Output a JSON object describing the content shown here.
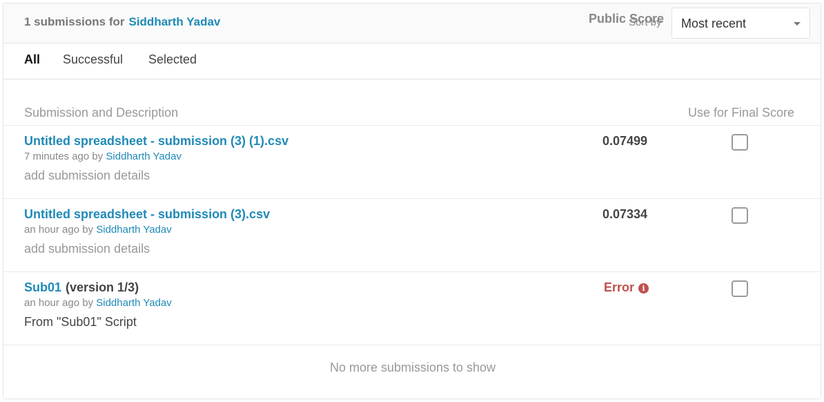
{
  "header": {
    "count_text": "1 submissions for",
    "user_name": "Siddharth Yadav",
    "sort_label": "Sort by",
    "sort_value": "Most recent"
  },
  "tabs": [
    {
      "label": "All",
      "active": true
    },
    {
      "label": "Successful",
      "active": false
    },
    {
      "label": "Selected",
      "active": false
    }
  ],
  "columns": {
    "submission": "Submission and Description",
    "public_score": "Public Score",
    "final_score": "Use for Final Score"
  },
  "submissions": [
    {
      "title": "Untitled spreadsheet - submission (3) (1).csv",
      "version": "",
      "time": "7 minutes ago by",
      "user": "Siddharth Yadav",
      "details": "add submission details",
      "score": "0.07499",
      "checked": false
    },
    {
      "title": "Untitled spreadsheet - submission (3).csv",
      "version": "",
      "time": "an hour ago by",
      "user": "Siddharth Yadav",
      "details": "add submission details",
      "score": "0.07334",
      "checked": false
    },
    {
      "title": "Sub01",
      "version": "(version 1/3)",
      "time": "an hour ago by",
      "user": "Siddharth Yadav",
      "details": "From \"Sub01\" Script",
      "score": "Error",
      "checked": false
    }
  ],
  "footer": {
    "text": "No more submissions to show"
  },
  "colors": {
    "link": "#1f8ab7",
    "error": "#c0504d"
  },
  "icons": {
    "info": "info-circle-icon",
    "caret": "chevron-down-icon"
  }
}
